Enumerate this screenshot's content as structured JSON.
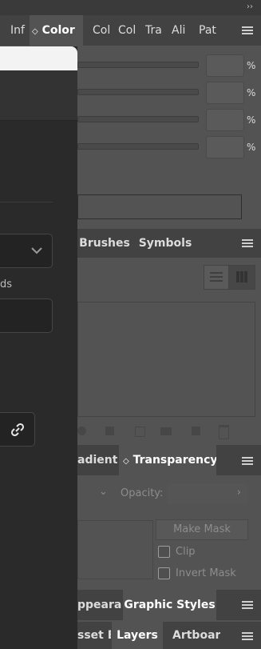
{
  "topbar": {
    "collapse": "››"
  },
  "tabs1": [
    {
      "label": "Inf"
    },
    {
      "label": "Color",
      "active": true,
      "prefix": "◇"
    },
    {
      "label": "Col"
    },
    {
      "label": "Col"
    },
    {
      "label": "Tra"
    },
    {
      "label": "Ali"
    },
    {
      "label": "Pat"
    }
  ],
  "color_panel": {
    "percent": [
      "%",
      "%",
      "%",
      "%"
    ]
  },
  "tabs2": [
    {
      "label": "Brushes"
    },
    {
      "label": "Symbols"
    }
  ],
  "tabs3": [
    {
      "label": "adient"
    },
    {
      "label": "Transparency",
      "active": true,
      "prefix": "◇"
    }
  ],
  "transparency": {
    "opacity_label": "Opacity:",
    "make_mask": "Make Mask",
    "clip": "Clip",
    "invert_mask": "Invert Mask"
  },
  "tabs4": [
    {
      "label": "ppearan"
    },
    {
      "label": "Graphic Styles",
      "active": true
    }
  ],
  "tabs5": [
    {
      "label": "sset Ex"
    },
    {
      "label": "Layers",
      "active": true
    },
    {
      "label": "Artboar"
    }
  ],
  "dialog": {
    "partial_label": "ds"
  },
  "colors": {
    "panel": "#535353",
    "tabbar": "#424242",
    "dialog": "#2a2a2a"
  }
}
